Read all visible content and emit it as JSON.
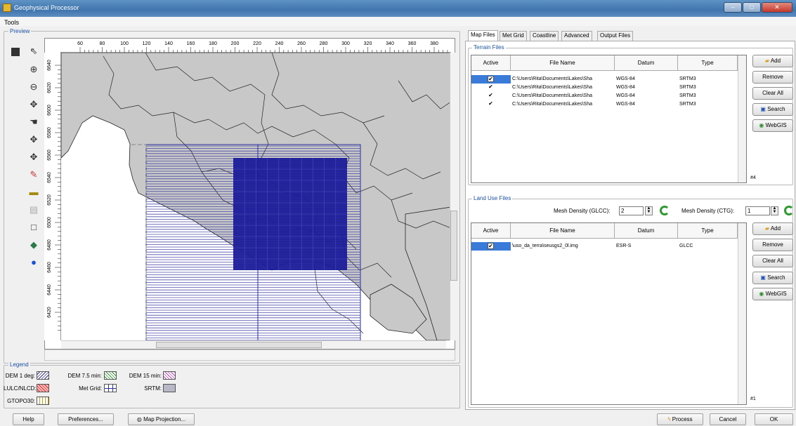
{
  "window": {
    "title": "Geophysical Processor"
  },
  "menu": {
    "tools": "Tools"
  },
  "preview": {
    "label": "Preview"
  },
  "ruler": {
    "x_ticks": [
      "60",
      "80",
      "100",
      "120",
      "140",
      "160",
      "180",
      "200",
      "220",
      "240",
      "260",
      "280",
      "300",
      "320",
      "340",
      "360",
      "380"
    ],
    "y_ticks": [
      "6640",
      "6620",
      "6600",
      "6580",
      "6560",
      "6540",
      "6520",
      "6500",
      "6480",
      "6460",
      "6440",
      "6420"
    ]
  },
  "toolbox": {
    "icons": [
      "stop-icon",
      "pointer-icon",
      "zoom-in-icon",
      "zoom-out-icon",
      "pan-icon",
      "hand-icon",
      "move-up-icon",
      "move-icon",
      "pencil-icon",
      "ruler-icon",
      "layers-icon",
      "rectangle-icon",
      "map-layer-icon",
      "info-icon"
    ]
  },
  "legend": {
    "label": "Legend",
    "items": [
      {
        "text": "DEM 1 deg:",
        "color": "#3030a0"
      },
      {
        "text": "DEM 7.5 min:",
        "color": "#2e9a2e"
      },
      {
        "text": "DEM 15 min:",
        "color": "#c040c0"
      },
      {
        "text": "LULC/NLCD:",
        "color": "#d03030"
      },
      {
        "text": "Met Grid:",
        "color": "#3030a0"
      },
      {
        "text": "SRTM:",
        "color": "#707090"
      },
      {
        "text": "GTOPO30:",
        "color": "#c0a020"
      }
    ]
  },
  "tabs": [
    "Map Files",
    "Met Grid",
    "Coastline",
    "Advanced",
    "Output Files"
  ],
  "terrain": {
    "label": "Terrain Files",
    "headers": [
      "Active",
      "File Name",
      "Datum",
      "Type"
    ],
    "rows": [
      {
        "active": "✔",
        "file": "C:\\Users\\Rita\\Documents\\Lakes\\Sha",
        "datum": "WGS-84",
        "type": "SRTM3"
      },
      {
        "active": "✔",
        "file": "C:\\Users\\Rita\\Documents\\Lakes\\Sha",
        "datum": "WGS-84",
        "type": "SRTM3"
      },
      {
        "active": "✔",
        "file": "C:\\Users\\Rita\\Documents\\Lakes\\Sha",
        "datum": "WGS-84",
        "type": "SRTM3"
      },
      {
        "active": "✔",
        "file": "C:\\Users\\Rita\\Documents\\Lakes\\Sha",
        "datum": "WGS-84",
        "type": "SRTM3"
      }
    ],
    "count": "#4",
    "buttons": [
      "Add",
      "Remove",
      "Clear All",
      "Search",
      "WebGIS"
    ]
  },
  "landuse": {
    "label": "Land Use Files",
    "glcc_label": "Mesh Density (GLCC):",
    "glcc_value": "2",
    "ctg_label": "Mesh Density (CTG):",
    "ctg_value": "1",
    "headers": [
      "Active",
      "File Name",
      "Datum",
      "Type"
    ],
    "rows": [
      {
        "active": "✔",
        "file": "\\uso_da_terra\\seusgs2_0l.img",
        "datum": "ESR-S",
        "type": "GLCC"
      }
    ],
    "count": "#1",
    "buttons": [
      "Add",
      "Remove",
      "Clear All",
      "Search",
      "WebGIS"
    ]
  },
  "bottom": {
    "help": "Help",
    "preferences": "Preferences...",
    "projection": "Map Projection...",
    "process": "Process",
    "cancel": "Cancel",
    "ok": "OK"
  },
  "map": {
    "land_color": "#c8c8c8",
    "grid_color": "#1c1c9a"
  }
}
